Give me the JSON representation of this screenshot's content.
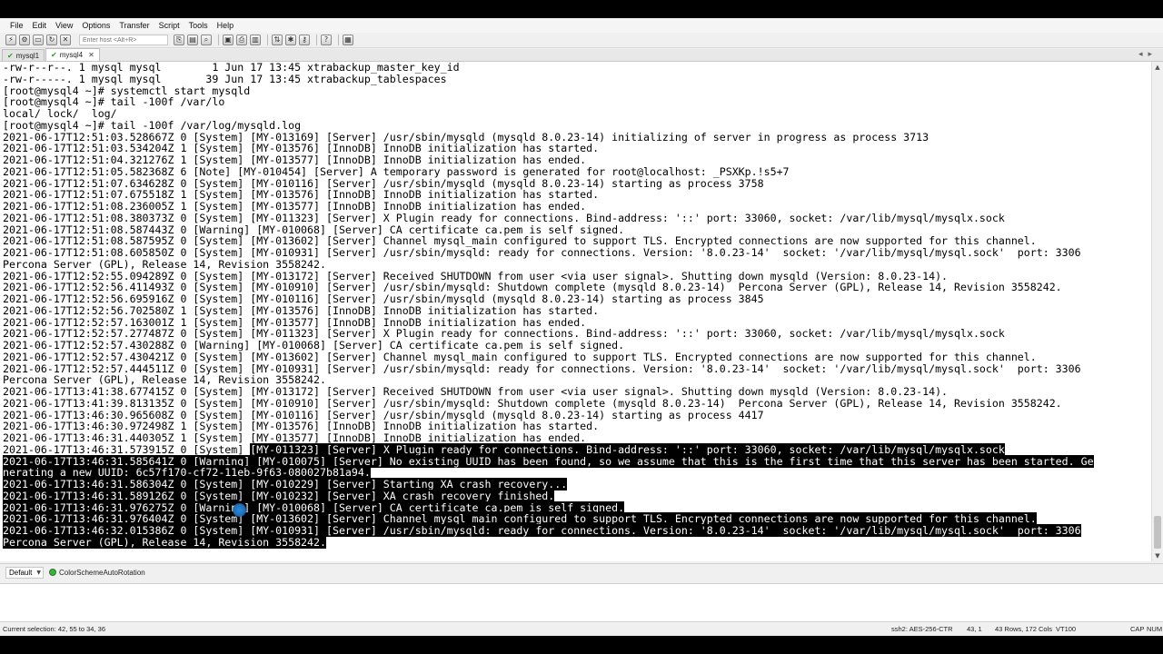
{
  "menu": [
    "File",
    "Edit",
    "View",
    "Options",
    "Transfer",
    "Script",
    "Tools",
    "Help"
  ],
  "toolbar": {
    "host_placeholder": "Enter host <Alt+R>"
  },
  "tabs": [
    {
      "label": "mysql1",
      "active": false
    },
    {
      "label": "mysql4",
      "active": true
    }
  ],
  "terminal": {
    "lines": [
      {
        "text": "-rw-r--r--. 1 mysql mysql        1 Jun 17 13:45 xtrabackup_master_key_id"
      },
      {
        "text": "-rw-r-----. 1 mysql mysql       39 Jun 17 13:45 xtrabackup_tablespaces"
      },
      {
        "text": "[root@mysql4 ~]# systemctl start mysqld"
      },
      {
        "text": "[root@mysql4 ~]# tail -100f /var/lo"
      },
      {
        "text": "local/ lock/  log/"
      },
      {
        "text": "[root@mysql4 ~]# tail -100f /var/log/mysqld.log"
      },
      {
        "text": "2021-06-17T12:51:03.528667Z 0 [System] [MY-013169] [Server] /usr/sbin/mysqld (mysqld 8.0.23-14) initializing of server in progress as process 3713"
      },
      {
        "text": "2021-06-17T12:51:03.534204Z 1 [System] [MY-013576] [InnoDB] InnoDB initialization has started."
      },
      {
        "text": "2021-06-17T12:51:04.321276Z 1 [System] [MY-013577] [InnoDB] InnoDB initialization has ended."
      },
      {
        "text": "2021-06-17T12:51:05.582368Z 6 [Note] [MY-010454] [Server] A temporary password is generated for root@localhost: _PSXKp.!s5+7"
      },
      {
        "text": "2021-06-17T12:51:07.634628Z 0 [System] [MY-010116] [Server] /usr/sbin/mysqld (mysqld 8.0.23-14) starting as process 3758"
      },
      {
        "text": "2021-06-17T12:51:07.675518Z 1 [System] [MY-013576] [InnoDB] InnoDB initialization has started."
      },
      {
        "text": "2021-06-17T12:51:08.236005Z 1 [System] [MY-013577] [InnoDB] InnoDB initialization has ended."
      },
      {
        "text": "2021-06-17T12:51:08.380373Z 0 [System] [MY-011323] [Server] X Plugin ready for connections. Bind-address: '::' port: 33060, socket: /var/lib/mysql/mysqlx.sock"
      },
      {
        "text": "2021-06-17T12:51:08.587443Z 0 [Warning] [MY-010068] [Server] CA certificate ca.pem is self signed."
      },
      {
        "text": "2021-06-17T12:51:08.587595Z 0 [System] [MY-013602] [Server] Channel mysql_main configured to support TLS. Encrypted connections are now supported for this channel."
      },
      {
        "text": "2021-06-17T12:51:08.605850Z 0 [System] [MY-010931] [Server] /usr/sbin/mysqld: ready for connections. Version: '8.0.23-14'  socket: '/var/lib/mysql/mysql.sock'  port: 3306"
      },
      {
        "text": "Percona Server (GPL), Release 14, Revision 3558242."
      },
      {
        "text": "2021-06-17T12:52:55.094289Z 0 [System] [MY-013172] [Server] Received SHUTDOWN from user <via user signal>. Shutting down mysqld (Version: 8.0.23-14)."
      },
      {
        "text": "2021-06-17T12:52:56.411493Z 0 [System] [MY-010910] [Server] /usr/sbin/mysqld: Shutdown complete (mysqld 8.0.23-14)  Percona Server (GPL), Release 14, Revision 3558242."
      },
      {
        "text": "2021-06-17T12:52:56.695916Z 0 [System] [MY-010116] [Server] /usr/sbin/mysqld (mysqld 8.0.23-14) starting as process 3845"
      },
      {
        "text": "2021-06-17T12:52:56.702580Z 1 [System] [MY-013576] [InnoDB] InnoDB initialization has started."
      },
      {
        "text": "2021-06-17T12:52:57.163001Z 1 [System] [MY-013577] [InnoDB] InnoDB initialization has ended."
      },
      {
        "text": "2021-06-17T12:52:57.277487Z 0 [System] [MY-011323] [Server] X Plugin ready for connections. Bind-address: '::' port: 33060, socket: /var/lib/mysql/mysqlx.sock"
      },
      {
        "text": "2021-06-17T12:52:57.430288Z 0 [Warning] [MY-010068] [Server] CA certificate ca.pem is self signed."
      },
      {
        "text": "2021-06-17T12:52:57.430421Z 0 [System] [MY-013602] [Server] Channel mysql_main configured to support TLS. Encrypted connections are now supported for this channel."
      },
      {
        "text": "2021-06-17T12:52:57.444511Z 0 [System] [MY-010931] [Server] /usr/sbin/mysqld: ready for connections. Version: '8.0.23-14'  socket: '/var/lib/mysql/mysql.sock'  port: 3306"
      },
      {
        "text": "Percona Server (GPL), Release 14, Revision 3558242."
      },
      {
        "text": "2021-06-17T13:41:38.677415Z 0 [System] [MY-013172] [Server] Received SHUTDOWN from user <via user signal>. Shutting down mysqld (Version: 8.0.23-14)."
      },
      {
        "text": "2021-06-17T13:41:39.813135Z 0 [System] [MY-010910] [Server] /usr/sbin/mysqld: Shutdown complete (mysqld 8.0.23-14)  Percona Server (GPL), Release 14, Revision 3558242."
      },
      {
        "text": "2021-06-17T13:46:30.965608Z 0 [System] [MY-010116] [Server] /usr/sbin/mysqld (mysqld 8.0.23-14) starting as process 4417"
      },
      {
        "text": "2021-06-17T13:46:30.972498Z 1 [System] [MY-013576] [InnoDB] InnoDB initialization has started."
      },
      {
        "text": "2021-06-17T13:46:31.440305Z 1 [System] [MY-013577] [InnoDB] InnoDB initialization has ended."
      },
      {
        "pre": "2021-06-17T13:46:31.573915Z 0 [System] ",
        "text": "[MY-011323] [Server] X Plugin ready for connections. Bind-address: '::' port: 33060, socket: /var/lib/mysql/mysqlx.sock"
      },
      {
        "text": "2021-06-17T13:46:31.585641Z 0 [Warning] [MY-010075] [Server] No existing UUID has been found, so we assume that this is the first time that this server has been started. Ge",
        "selected": true
      },
      {
        "text": "nerating a new UUID: 6c57f170-cf72-11eb-9f63-080027b81a94.",
        "selected": true
      },
      {
        "text": "2021-06-17T13:46:31.586304Z 0 [System] [MY-010229] [Server] Starting XA crash recovery...",
        "selected": true
      },
      {
        "text": "2021-06-17T13:46:31.589126Z 0 [System] [MY-010232] [Server] XA crash recovery finished.",
        "selected": true
      },
      {
        "text": "2021-06-17T13:46:31.976275Z 0 [Warning] [MY-010068] [Server] CA certificate ca.pem is self signed.",
        "selected": true
      },
      {
        "text": "2021-06-17T13:46:31.976404Z 0 [System] [MY-013602] [Server] Channel mysql_main configured to support TLS. Encrypted connections are now supported for this channel.",
        "selected": true
      },
      {
        "text": "2021-06-17T13:46:32.015386Z 0 [System] [MY-010931] [Server] /usr/sbin/mysqld: ready for connections. Version: '8.0.23-14'  socket: '/var/lib/mysql/mysql.sock'  port: 3306",
        "selected": true
      },
      {
        "text": "Percona Server (GPL), Release 14, Revision 3558242.",
        "selected": true
      }
    ]
  },
  "scheme": {
    "selected": "Default",
    "button_label": "ColorSchemeAutoRotation"
  },
  "status": {
    "selection": "Current selection: 42, 55 to 34, 36",
    "cipher": "ssh2: AES-256-CTR",
    "position": "43,  1",
    "size": "43 Rows, 172 Cols",
    "terminal_type": "VT100",
    "caps": "CAP",
    "num": "NUM"
  }
}
